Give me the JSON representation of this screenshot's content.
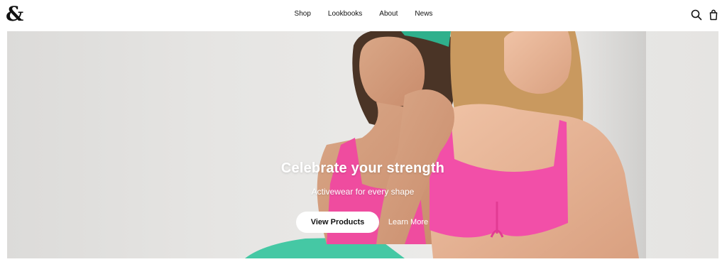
{
  "header": {
    "logo_text": "&",
    "nav": [
      "Shop",
      "Lookbooks",
      "About",
      "News"
    ],
    "icons": [
      "search-icon",
      "shopping-bag-icon"
    ]
  },
  "hero": {
    "title": "Celebrate your strength",
    "subtitle": "Activewear for every shape",
    "primary_button": "View Products",
    "secondary_link": "Learn More"
  },
  "colors": {
    "background": "#ffffff",
    "hero_background": "#e7e6e4",
    "text": "#111111",
    "hero_text": "#ffffff",
    "accent_pink": "#f24fa8",
    "accent_green": "#3fc3a0"
  }
}
